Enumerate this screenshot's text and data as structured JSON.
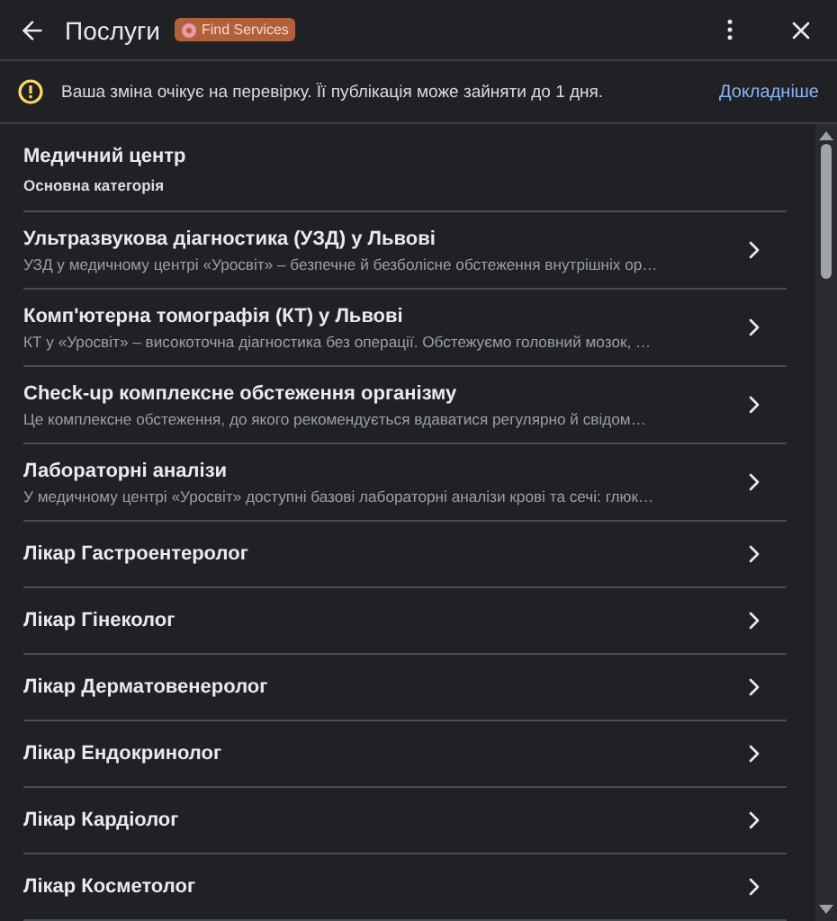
{
  "header": {
    "title": "Послуги",
    "badge": "Find Services"
  },
  "notice": {
    "text": "Ваша зміна очікує на перевірку. Її публікація може зайняти до 1 дня.",
    "link": "Докладніше"
  },
  "category": {
    "title": "Медичний центр",
    "subtitle": "Основна категорія"
  },
  "services": [
    {
      "title": "Ультразвукова діагностика (УЗД) у Львові",
      "description": "УЗД у медичному центрі «Уросвіт» – безпечне й безболісне обстеження внутрішніх ор…"
    },
    {
      "title": "Комп'ютерна томографія (КТ) у Львові",
      "description": "КТ у «Уросвіт» – високоточна діагностика без операції. Обстежуємо головний мозок, …"
    },
    {
      "title": "Check-up комплексне обстеження організму",
      "description": "Це комплексне обстеження, до якого рекомендується вдаватися регулярно й свідом…"
    },
    {
      "title": "Лабораторні аналізи",
      "description": "У медичному центрі «Уросвіт» доступні базові лабораторні аналізи крові та сечі: глюк…"
    },
    {
      "title": "Лікар Гастроентеролог"
    },
    {
      "title": "Лікар Гінеколог"
    },
    {
      "title": "Лікар Дерматовенеролог"
    },
    {
      "title": "Лікар Ендокринолог"
    },
    {
      "title": "Лікар Кардіолог"
    },
    {
      "title": "Лікар Косметолог"
    }
  ]
}
